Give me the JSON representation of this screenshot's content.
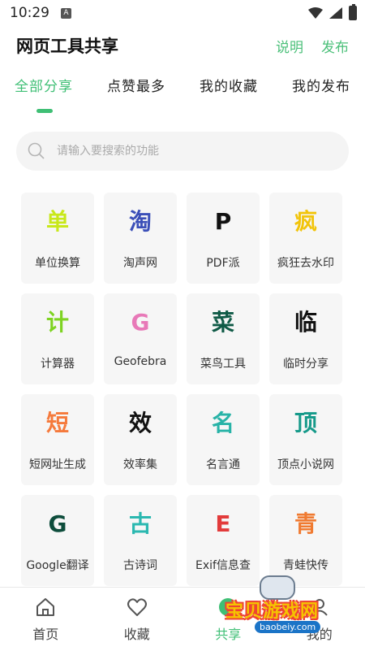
{
  "status_bar": {
    "time": "10:29",
    "notif_glyph": "A"
  },
  "app_bar": {
    "title": "网页工具共享",
    "actions": [
      "说明",
      "发布"
    ]
  },
  "tabs": [
    "全部分享",
    "点赞最多",
    "我的收藏",
    "我的发布"
  ],
  "active_tab": 0,
  "search": {
    "placeholder": "请输入要搜索的功能"
  },
  "tools": [
    {
      "glyph": "单",
      "label": "单位换算",
      "color": "#c8e81a"
    },
    {
      "glyph": "淘",
      "label": "淘声网",
      "color": "#3b4fb8"
    },
    {
      "glyph": "P",
      "label": "PDF派",
      "color": "#111111"
    },
    {
      "glyph": "疯",
      "label": "疯狂去水印",
      "color": "#f2c40a"
    },
    {
      "glyph": "计",
      "label": "计算器",
      "color": "#7ed321"
    },
    {
      "glyph": "G",
      "label": "Geofebra",
      "color": "#e879b8"
    },
    {
      "glyph": "菜",
      "label": "菜鸟工具",
      "color": "#0f5a46"
    },
    {
      "glyph": "临",
      "label": "临时分享",
      "color": "#111111"
    },
    {
      "glyph": "短",
      "label": "短网址生成",
      "color": "#f57a3c"
    },
    {
      "glyph": "效",
      "label": "效率集",
      "color": "#111111"
    },
    {
      "glyph": "名",
      "label": "名言通",
      "color": "#28b3a7"
    },
    {
      "glyph": "顶",
      "label": "顶点小说网",
      "color": "#169a8a"
    },
    {
      "glyph": "G",
      "label": "Google翻译",
      "color": "#0e4d3c"
    },
    {
      "glyph": "古",
      "label": "古诗词",
      "color": "#2bb8b0"
    },
    {
      "glyph": "E",
      "label": "Exif信息查",
      "color": "#e23b3b"
    },
    {
      "glyph": "青",
      "label": "青蛙快传",
      "color": "#f07a30"
    }
  ],
  "bottom_nav": [
    {
      "label": "首页",
      "icon": "home-icon"
    },
    {
      "label": "收藏",
      "icon": "heart-icon"
    },
    {
      "label": "共享",
      "icon": "share-icon"
    },
    {
      "label": "我的",
      "icon": "user-icon"
    }
  ],
  "active_nav": 2,
  "watermark": {
    "text": "宝贝游戏网",
    "url": "baobeiy.com"
  },
  "colors": {
    "accent": "#3fbf75"
  }
}
